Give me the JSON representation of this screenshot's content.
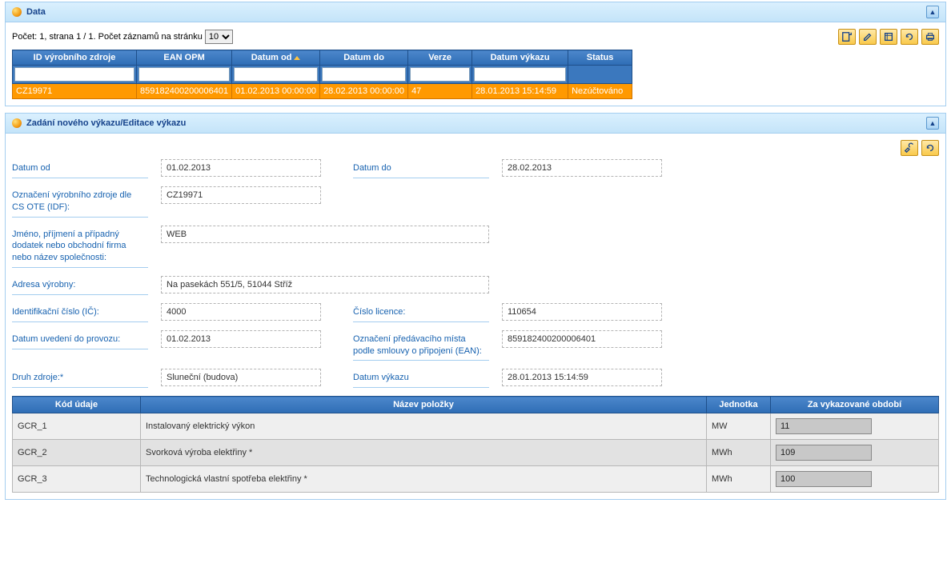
{
  "panel1": {
    "title": "Data",
    "paging_prefix": "Počet: 1, strana 1 / 1. Počet záznamů na stránku",
    "page_size": "10",
    "columns": {
      "id": "ID výrobního zdroje",
      "ean": "EAN OPM",
      "from": "Datum od",
      "to": "Datum do",
      "ver": "Verze",
      "rep": "Datum výkazu",
      "status": "Status"
    },
    "row": {
      "id": "CZ19971",
      "ean": "859182400200006401",
      "from": "01.02.2013 00:00:00",
      "to": "28.02.2013 00:00:00",
      "ver": "47",
      "rep": "28.01.2013 15:14:59",
      "status": "Nezúčtováno"
    }
  },
  "panel2": {
    "title": "Zadání nového výkazu/Editace výkazu",
    "labels": {
      "date_from": "Datum od",
      "date_to": "Datum do",
      "idf": "Označení výrobního zdroje dle CS OTE (IDF):",
      "name": "Jméno, příjmení a případný dodatek nebo obchodní firma nebo název společnosti:",
      "address": "Adresa výrobny:",
      "ic": "Identifikační číslo (IČ):",
      "licence": "Číslo licence:",
      "commission": "Datum uvedení do provozu:",
      "ean": "Označení předávacího místa podle smlouvy o připojení (EAN):",
      "type": "Druh zdroje:*",
      "report_date": "Datum výkazu"
    },
    "values": {
      "date_from": "01.02.2013",
      "date_to": "28.02.2013",
      "idf": "CZ19971",
      "name": "WEB",
      "address": "Na pasekách 551/5, 51044 Stříž",
      "ic": "4000",
      "licence": "110654",
      "commission": "01.02.2013",
      "ean": "859182400200006401",
      "type": "Sluneční (budova)",
      "report_date": "28.01.2013 15:14:59"
    },
    "detail_headers": {
      "code": "Kód údaje",
      "name": "Název položky",
      "unit": "Jednotka",
      "period": "Za vykazované období"
    },
    "detail_rows": [
      {
        "code": "GCR_1",
        "name": "Instalovaný elektrický výkon",
        "unit": "MW",
        "val": "11"
      },
      {
        "code": "GCR_2",
        "name": "Svorková výroba elektřiny *",
        "unit": "MWh",
        "val": "109"
      },
      {
        "code": "GCR_3",
        "name": "Technologická vlastní spotřeba elektřiny *",
        "unit": "MWh",
        "val": "100"
      }
    ]
  }
}
